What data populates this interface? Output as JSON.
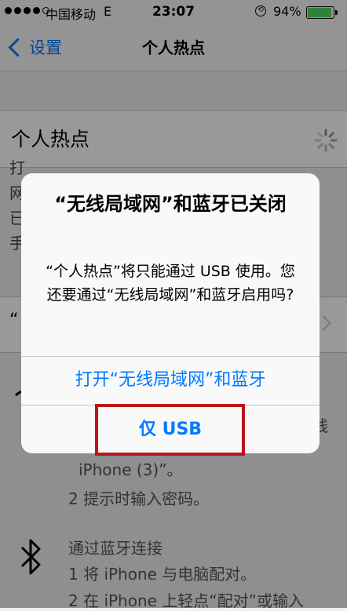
{
  "status_bar": {
    "carrier": "中国移动",
    "network": "E",
    "time": "23:07",
    "battery": "94%",
    "battery_level": 0.94,
    "battery_color": "#4cd964"
  },
  "nav": {
    "back_label": "设置",
    "title": "个人热点"
  },
  "settings": {
    "hotspot_label": "个人热点",
    "left_fragments": [
      "打",
      "网",
      "已",
      "手"
    ],
    "row_fragment": "“",
    "right_fragment": "线",
    "instructions": [
      "iPhone (3)”。",
      "2 提示时输入密码。",
      "通过蓝牙连接",
      "1 将 iPhone 与电脑配对。",
      "2 在 iPhone 上轻点“配对”或输入"
    ]
  },
  "alert": {
    "title": "“无线局域网”和蓝牙已关闭",
    "message": "“个人热点”将只能通过 USB 使用。您还要通过“无线局域网”和蓝牙启用吗?",
    "button_primary": "打开“无线局域网”和蓝牙",
    "button_usb": "仅 USB",
    "accent_color": "#007aff",
    "highlight_color": "#b9151b"
  }
}
